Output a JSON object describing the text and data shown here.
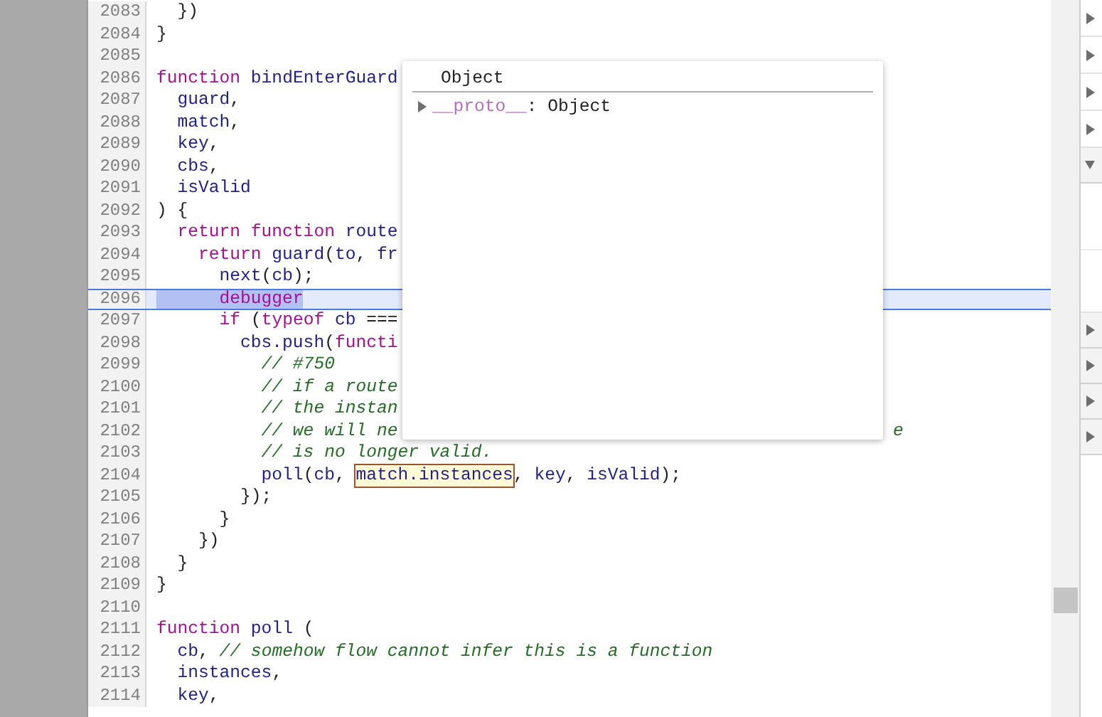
{
  "editor": {
    "lines": [
      {
        "number": "2083",
        "current": false,
        "selected": false,
        "tokens": [
          {
            "kind": "plain",
            "text": "  })"
          }
        ]
      },
      {
        "number": "2084",
        "current": false,
        "selected": false,
        "tokens": [
          {
            "kind": "plain",
            "text": "}"
          }
        ]
      },
      {
        "number": "2085",
        "current": false,
        "selected": false
      },
      {
        "number": "2086",
        "current": false,
        "selected": false,
        "tokens": [
          {
            "kind": "keyword",
            "text": "function"
          },
          {
            "kind": "name",
            "text": " bindEnterGuard"
          }
        ]
      },
      {
        "number": "2087",
        "current": false,
        "selected": false,
        "tokens": [
          {
            "kind": "name",
            "text": "  guard"
          },
          {
            "kind": "plain",
            "text": ","
          }
        ]
      },
      {
        "number": "2088",
        "current": false,
        "selected": false,
        "tokens": [
          {
            "kind": "name",
            "text": "  match"
          },
          {
            "kind": "plain",
            "text": ","
          }
        ]
      },
      {
        "number": "2089",
        "current": false,
        "selected": false,
        "tokens": [
          {
            "kind": "name",
            "text": "  key"
          },
          {
            "kind": "plain",
            "text": ","
          }
        ]
      },
      {
        "number": "2090",
        "current": false,
        "selected": false,
        "tokens": [
          {
            "kind": "name",
            "text": "  cbs"
          },
          {
            "kind": "plain",
            "text": ","
          }
        ]
      },
      {
        "number": "2091",
        "current": false,
        "selected": false,
        "tokens": [
          {
            "kind": "name",
            "text": "  isValid"
          }
        ]
      },
      {
        "number": "2092",
        "current": false,
        "selected": false,
        "tokens": [
          {
            "kind": "plain",
            "text": ") {"
          }
        ]
      },
      {
        "number": "2093",
        "current": false,
        "selected": false,
        "tokens": [
          {
            "kind": "keyword",
            "text": "  return function"
          },
          {
            "kind": "name",
            "text": " route"
          }
        ]
      },
      {
        "number": "2094",
        "current": false,
        "selected": false,
        "tokens": [
          {
            "kind": "keyword",
            "text": "    return"
          },
          {
            "kind": "name",
            "text": " guard"
          },
          {
            "kind": "plain",
            "text": "("
          },
          {
            "kind": "name",
            "text": "to"
          },
          {
            "kind": "plain",
            "text": ", "
          },
          {
            "kind": "name",
            "text": "fr"
          }
        ]
      },
      {
        "number": "2095",
        "current": false,
        "selected": false,
        "tokens": [
          {
            "kind": "name",
            "text": "      next"
          },
          {
            "kind": "plain",
            "text": "("
          },
          {
            "kind": "name",
            "text": "cb"
          },
          {
            "kind": "plain",
            "text": ");"
          }
        ]
      },
      {
        "number": "2096",
        "current": true,
        "selected": true,
        "tokens": [
          {
            "kind": "keyword",
            "text": "      debugger"
          }
        ]
      },
      {
        "number": "2097",
        "current": false,
        "selected": false,
        "tokens": [
          {
            "kind": "keyword",
            "text": "      if"
          },
          {
            "kind": "plain",
            "text": " ("
          },
          {
            "kind": "keyword",
            "text": "typeof"
          },
          {
            "kind": "name",
            "text": " cb"
          },
          {
            "kind": "plain",
            "text": " ==="
          }
        ]
      },
      {
        "number": "2098",
        "current": false,
        "selected": false,
        "tokens": [
          {
            "kind": "name",
            "text": "        cbs.push"
          },
          {
            "kind": "plain",
            "text": "("
          },
          {
            "kind": "keyword",
            "text": "functi"
          }
        ]
      },
      {
        "number": "2099",
        "current": false,
        "selected": false,
        "tokens": [
          {
            "kind": "comment",
            "text": "          // #750"
          }
        ]
      },
      {
        "number": "2100",
        "current": false,
        "selected": false,
        "tokens": [
          {
            "kind": "comment",
            "text": "          // if a route"
          }
        ]
      },
      {
        "number": "2101",
        "current": false,
        "selected": false,
        "tokens": [
          {
            "kind": "comment",
            "text": "          // the instan"
          }
        ]
      },
      {
        "number": "2102",
        "current": false,
        "selected": false,
        "tokens": [
          {
            "kind": "comment",
            "text": "          // we will ne"
          }
        ],
        "tail": "e"
      },
      {
        "number": "2103",
        "current": false,
        "selected": false,
        "tokens": [
          {
            "kind": "comment",
            "text": "          // is no longer valid."
          }
        ]
      },
      {
        "number": "2104",
        "current": false,
        "selected": false,
        "tokens": [
          {
            "kind": "name",
            "text": "          poll"
          },
          {
            "kind": "plain",
            "text": "("
          },
          {
            "kind": "name",
            "text": "cb"
          },
          {
            "kind": "plain",
            "text": ", "
          },
          {
            "kind": "hovered",
            "text": "match.instances"
          },
          {
            "kind": "plain",
            "text": ", "
          },
          {
            "kind": "name",
            "text": "key"
          },
          {
            "kind": "plain",
            "text": ", "
          },
          {
            "kind": "name",
            "text": "isValid"
          },
          {
            "kind": "plain",
            "text": ");"
          }
        ]
      },
      {
        "number": "2105",
        "current": false,
        "selected": false,
        "tokens": [
          {
            "kind": "plain",
            "text": "        });"
          }
        ]
      },
      {
        "number": "2106",
        "current": false,
        "selected": false,
        "tokens": [
          {
            "kind": "plain",
            "text": "      }"
          }
        ]
      },
      {
        "number": "2107",
        "current": false,
        "selected": false,
        "tokens": [
          {
            "kind": "plain",
            "text": "    })"
          }
        ]
      },
      {
        "number": "2108",
        "current": false,
        "selected": false,
        "tokens": [
          {
            "kind": "plain",
            "text": "  }"
          }
        ]
      },
      {
        "number": "2109",
        "current": false,
        "selected": false,
        "tokens": [
          {
            "kind": "plain",
            "text": "}"
          }
        ]
      },
      {
        "number": "2110",
        "current": false,
        "selected": false
      },
      {
        "number": "2111",
        "current": false,
        "selected": false,
        "tokens": [
          {
            "kind": "keyword",
            "text": "function"
          },
          {
            "kind": "name",
            "text": " poll"
          },
          {
            "kind": "plain",
            "text": " ("
          }
        ]
      },
      {
        "number": "2112",
        "current": false,
        "selected": false,
        "tokens": [
          {
            "kind": "name",
            "text": "  cb"
          },
          {
            "kind": "plain",
            "text": ", "
          },
          {
            "kind": "comment",
            "text": "// somehow flow cannot infer this is a function"
          }
        ]
      },
      {
        "number": "2113",
        "current": false,
        "selected": false,
        "tokens": [
          {
            "kind": "name",
            "text": "  instances"
          },
          {
            "kind": "plain",
            "text": ","
          }
        ]
      },
      {
        "number": "2114",
        "current": false,
        "selected": false,
        "tokens": [
          {
            "kind": "name",
            "text": "  key"
          },
          {
            "kind": "plain",
            "text": ","
          }
        ]
      }
    ]
  },
  "popover": {
    "title": "Object",
    "properties": [
      {
        "name": "__proto__",
        "value": ": Object",
        "expanded": false
      }
    ]
  },
  "side_pane": {
    "sections": [
      {
        "kind": "row",
        "expanded": false
      },
      {
        "kind": "row",
        "expanded": false
      },
      {
        "kind": "row",
        "expanded": false
      },
      {
        "kind": "row",
        "expanded": false
      },
      {
        "kind": "header",
        "expanded": true
      },
      {
        "kind": "header",
        "expanded": false
      },
      {
        "kind": "header",
        "expanded": false
      },
      {
        "kind": "header",
        "expanded": false
      },
      {
        "kind": "header",
        "expanded": false
      }
    ]
  }
}
